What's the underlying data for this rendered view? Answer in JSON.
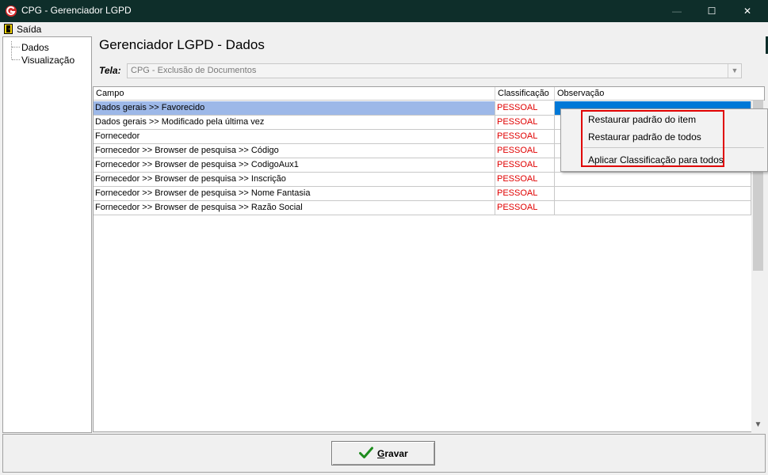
{
  "window": {
    "title": "CPG - Gerenciador LGPD",
    "controls": {
      "minimize": "—",
      "maximize": "☐",
      "close": "✕"
    }
  },
  "menu": {
    "exit_label": "Saída",
    "exit_icon": "door-exit-icon"
  },
  "sidebar": {
    "items": [
      {
        "label": "Dados"
      },
      {
        "label": "Visualização"
      }
    ]
  },
  "main": {
    "title": "Gerenciador LGPD - Dados",
    "tela_label": "Tela:",
    "tela_value": "CPG - Exclusão de Documentos"
  },
  "grid": {
    "headers": {
      "campo": "Campo",
      "classificacao": "Classificação",
      "observacao": "Observação"
    },
    "rows": [
      {
        "campo": "Dados gerais >> Favorecido",
        "classificacao": "PESSOAL",
        "observacao": ""
      },
      {
        "campo": "Dados gerais >> Modificado pela última vez",
        "classificacao": "PESSOAL",
        "observacao": ""
      },
      {
        "campo": "Fornecedor",
        "classificacao": "PESSOAL",
        "observacao": ""
      },
      {
        "campo": "Fornecedor >> Browser de pesquisa >> Código",
        "classificacao": "PESSOAL",
        "observacao": ""
      },
      {
        "campo": "Fornecedor >> Browser de pesquisa >> CodigoAux1",
        "classificacao": "PESSOAL",
        "observacao": ""
      },
      {
        "campo": "Fornecedor >> Browser de pesquisa >> Inscrição",
        "classificacao": "PESSOAL",
        "observacao": ""
      },
      {
        "campo": "Fornecedor >> Browser de pesquisa >> Nome Fantasia",
        "classificacao": "PESSOAL",
        "observacao": ""
      },
      {
        "campo": "Fornecedor >> Browser de pesquisa >> Razão Social",
        "classificacao": "PESSOAL",
        "observacao": ""
      }
    ],
    "selected_row": 0
  },
  "context_menu": {
    "items": [
      {
        "label": "Restaurar padrão do item"
      },
      {
        "label": "Restaurar padrão de todos"
      },
      {
        "label": "Aplicar Classificação para todos"
      }
    ]
  },
  "footer": {
    "save_label_first": "G",
    "save_label_rest": "ravar"
  },
  "colors": {
    "titlebar": "#0e2e2a",
    "classification_text": "#e00000",
    "selected_row": "#9db8e8",
    "selected_cell": "#0078d7",
    "highlight_border": "#e00000",
    "check_green": "#1e8c1e"
  }
}
